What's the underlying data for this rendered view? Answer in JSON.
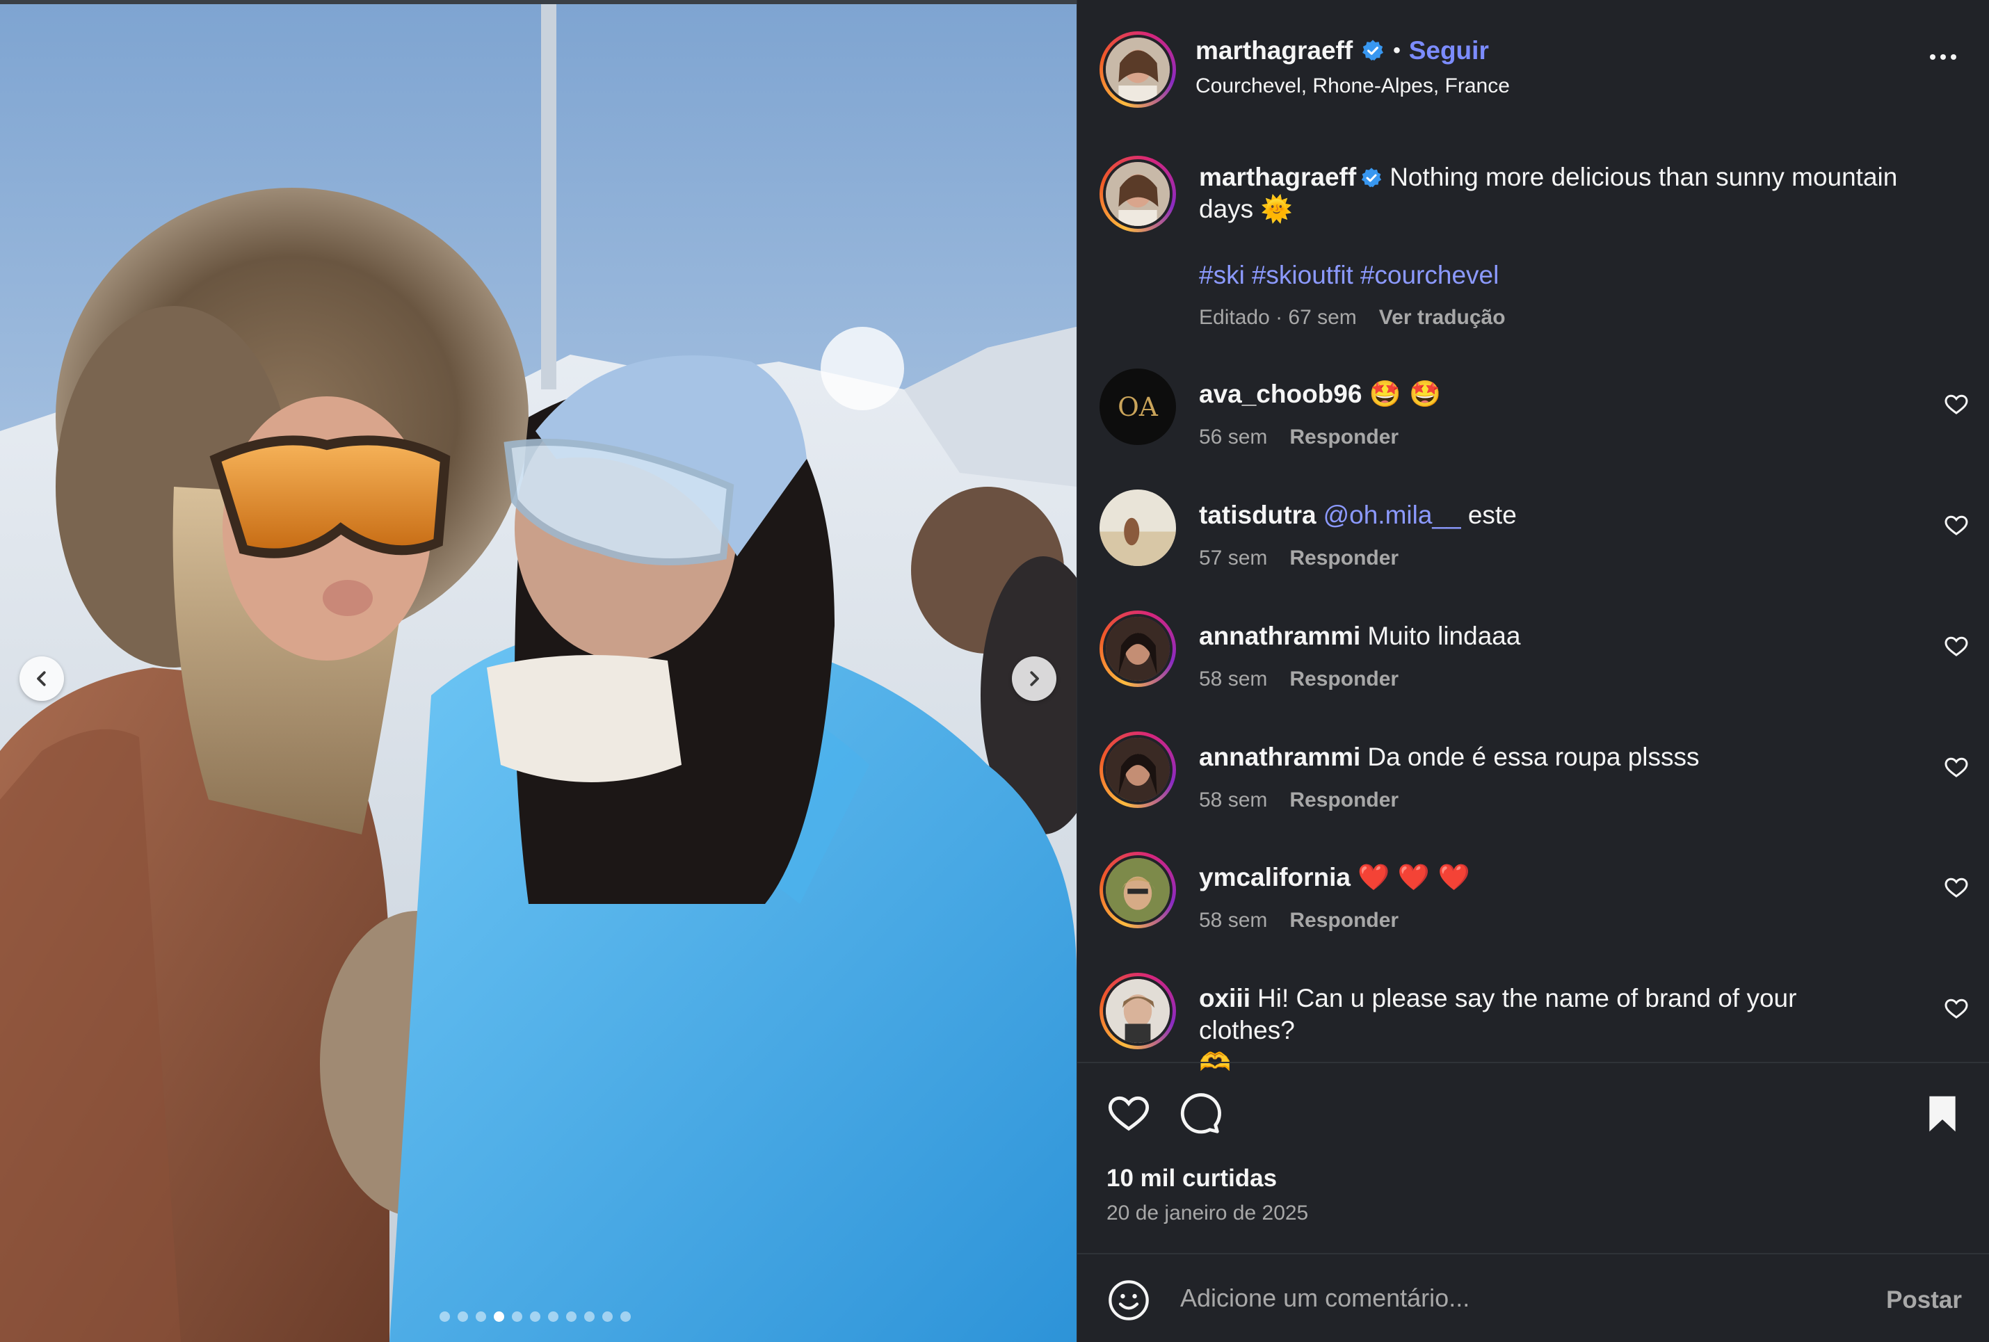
{
  "post": {
    "author": "marthagraeff",
    "follow_label": "Seguir",
    "separator": "•",
    "location": "Courchevel, Rhone-Alpes, France",
    "caption_text": "Nothing more delicious than sunny mountain days",
    "caption_emoji": "🌞",
    "hashtags": [
      "#ski",
      "#skioutfit",
      "#courchevel"
    ],
    "edited": "Editado · 67 sem",
    "translate_label": "Ver tradução",
    "likes": "10 mil curtidas",
    "date": "20 de janeiro de 2025",
    "carousel_count": 11,
    "carousel_active_index": 3
  },
  "comments": [
    {
      "user": "ava_choob96",
      "text": "🤩 🤩",
      "mention": "",
      "age": "56 sem",
      "reply": "Responder"
    },
    {
      "user": "tatisdutra",
      "mention": "@oh.mila__",
      "text": "este",
      "age": "57 sem",
      "reply": "Responder"
    },
    {
      "user": "annathrammi",
      "text": "Muito lindaaa",
      "mention": "",
      "age": "58 sem",
      "reply": "Responder"
    },
    {
      "user": "annathrammi",
      "text": "Da onde é essa roupa plssss",
      "mention": "",
      "age": "58 sem",
      "reply": "Responder"
    },
    {
      "user": "ymcalifornia",
      "text": "❤️ ❤️ ❤️",
      "mention": "",
      "age": "58 sem",
      "reply": "Responder"
    },
    {
      "user": "oxiii",
      "text": "Hi! Can u please say the name of brand of your clothes?",
      "text2": "🫶",
      "mention": "",
      "age": "",
      "reply": ""
    }
  ],
  "composer": {
    "placeholder": "Adicione um comentário...",
    "post_label": "Postar"
  },
  "colors": {
    "panel_bg": "#212328",
    "link_blue": "#7c8cff",
    "hashtag_blue": "#8c9aff",
    "muted_text": "#a8a8a8",
    "verified_blue": "#3897f0"
  },
  "icons": {
    "header_more": "more-horizontal-icon",
    "verified": "verified-badge-icon",
    "like": "heart-icon",
    "comment": "comment-bubble-icon",
    "save": "bookmark-icon",
    "emoji": "smiley-icon",
    "prev": "chevron-left-icon",
    "next": "chevron-right-icon"
  }
}
